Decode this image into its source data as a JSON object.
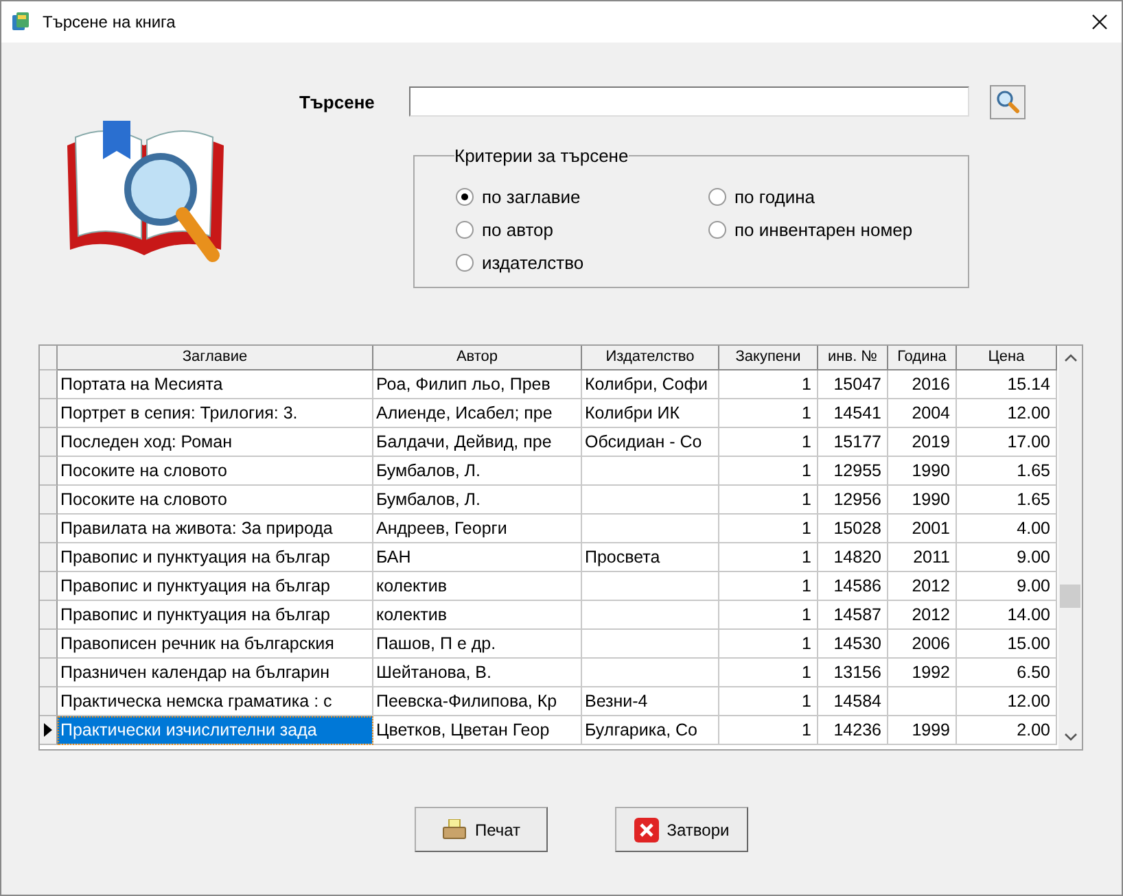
{
  "window": {
    "title": "Търсене на книга"
  },
  "search": {
    "label": "Търсене"
  },
  "criteria": {
    "title": "Критерии за търсене",
    "options": [
      {
        "label": "по заглавие",
        "checked": true
      },
      {
        "label": "по автор",
        "checked": false
      },
      {
        "label": "издателство",
        "checked": false
      },
      {
        "label": "по година",
        "checked": false
      },
      {
        "label": "по инвентарен номер",
        "checked": false
      }
    ]
  },
  "table": {
    "columns": [
      "Заглавие",
      "Автор",
      "Издателство",
      "Закупени",
      "инв. №",
      "Година",
      "Цена"
    ],
    "rows": [
      {
        "title": "Портата на Месията",
        "author": "Роа, Филип льо, Прев",
        "publisher": "Колибри, Софи",
        "bought": "1",
        "inv": "15047",
        "year": "2016",
        "price": "15.14",
        "selected": false
      },
      {
        "title": "Портрет в сепия: Трилогия: 3.",
        "author": "Алиенде, Исабел; пре",
        "publisher": "Колибри ИК",
        "bought": "1",
        "inv": "14541",
        "year": "2004",
        "price": "12.00",
        "selected": false
      },
      {
        "title": "Последен ход: Роман",
        "author": "Балдачи, Дейвид, пре",
        "publisher": "Обсидиан - Со",
        "bought": "1",
        "inv": "15177",
        "year": "2019",
        "price": "17.00",
        "selected": false
      },
      {
        "title": "Посоките на словото",
        "author": "Бумбалов, Л.",
        "bought": "1",
        "inv": "12955",
        "year": "1990",
        "price": "1.65",
        "selected": false
      },
      {
        "title": "Посоките на словото",
        "author": "Бумбалов, Л.",
        "bought": "1",
        "inv": "12956",
        "year": "1990",
        "price": "1.65",
        "selected": false
      },
      {
        "title": "Правилата на живота: За природа",
        "author": "Андреев, Георги",
        "bought": "1",
        "inv": "15028",
        "year": "2001",
        "price": "4.00",
        "selected": false
      },
      {
        "title": "Правопис и пунктуация на българ",
        "author": "БАН",
        "publisher": "Просвета",
        "bought": "1",
        "inv": "14820",
        "year": "2011",
        "price": "9.00",
        "selected": false
      },
      {
        "title": "Правопис и пунктуация на българ",
        "author": "колектив",
        "bought": "1",
        "inv": "14586",
        "year": "2012",
        "price": "9.00",
        "selected": false
      },
      {
        "title": "Правопис и пунктуация на българ",
        "author": "колектив",
        "bought": "1",
        "inv": "14587",
        "year": "2012",
        "price": "14.00",
        "selected": false
      },
      {
        "title": "Правописен речник на българския",
        "author": "Пашов, П е др.",
        "bought": "1",
        "inv": "14530",
        "year": "2006",
        "price": "15.00",
        "selected": false
      },
      {
        "title": "Празничен календар на българин",
        "author": "Шейтанова, В.",
        "bought": "1",
        "inv": "13156",
        "year": "1992",
        "price": "6.50",
        "selected": false
      },
      {
        "title": "Практическа немска граматика : с",
        "author": "Пеевска-Филипова, Кр",
        "publisher": "Везни-4",
        "bought": "1",
        "inv": "14584",
        "price": "12.00",
        "selected": false
      },
      {
        "title": "Практически изчислителни зада",
        "author": "Цветков, Цветан Геор",
        "publisher": "Булгарика, Со",
        "bought": "1",
        "inv": "14236",
        "year": "1999",
        "price": "2.00",
        "selected": true
      }
    ]
  },
  "buttons": [
    {
      "kind": "print",
      "label": "Печат"
    },
    {
      "kind": "close",
      "label": "Затвори"
    }
  ]
}
